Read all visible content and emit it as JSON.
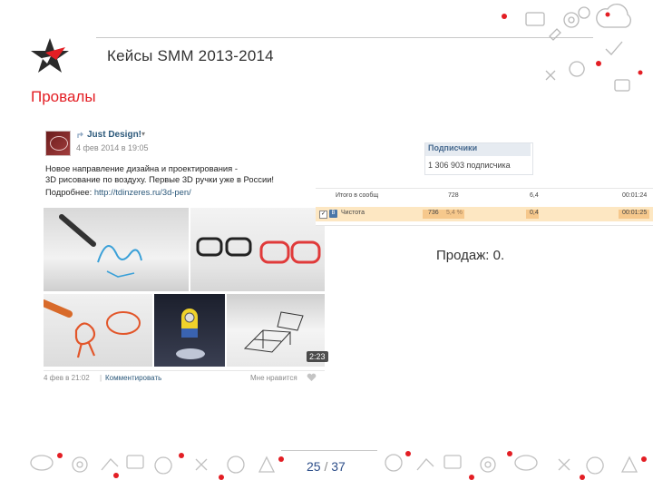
{
  "slide": {
    "title": "Кейсы SMM 2013-2014",
    "section": "Провалы",
    "sales_text": "Продаж: 0.",
    "page_current": "25",
    "page_separator": "/",
    "page_total": "37"
  },
  "post": {
    "author": "Just Design!",
    "caret": "▾",
    "date": "4 фев 2014 в 19:05",
    "text_line1": "Новое направление дизайна и проектирования -",
    "text_line2": "3D рисование по воздуху. Первые 3D ручки уже в России!",
    "link_label": "Подробнее:",
    "link_url": "http://tdinzeres.ru/3d-pen/",
    "video_duration": "2:23",
    "footer_date": "4 фев в 21:02",
    "footer_separator": "|",
    "footer_comment": "Комментировать",
    "footer_like": "Мне нравится",
    "icons": [
      "repost-icon",
      "heart-icon"
    ]
  },
  "subscribers": {
    "title": "Подписчики",
    "count": "1 306 903 подписчика"
  },
  "stats": {
    "row1": {
      "label": "Итого в сообщ",
      "v1": "728",
      "v2": "6,4",
      "v3": "00:01:24"
    },
    "row2": {
      "label": "Чистотa",
      "v1": "736",
      "v1_extra": "5,4 %",
      "v2": "0,4",
      "v3": "00:01:25"
    }
  },
  "colors": {
    "accent_red": "#e31e24",
    "vk_blue": "#2b587a",
    "highlight_row": "#fde7c2",
    "page_number": "#2e4f8a"
  }
}
